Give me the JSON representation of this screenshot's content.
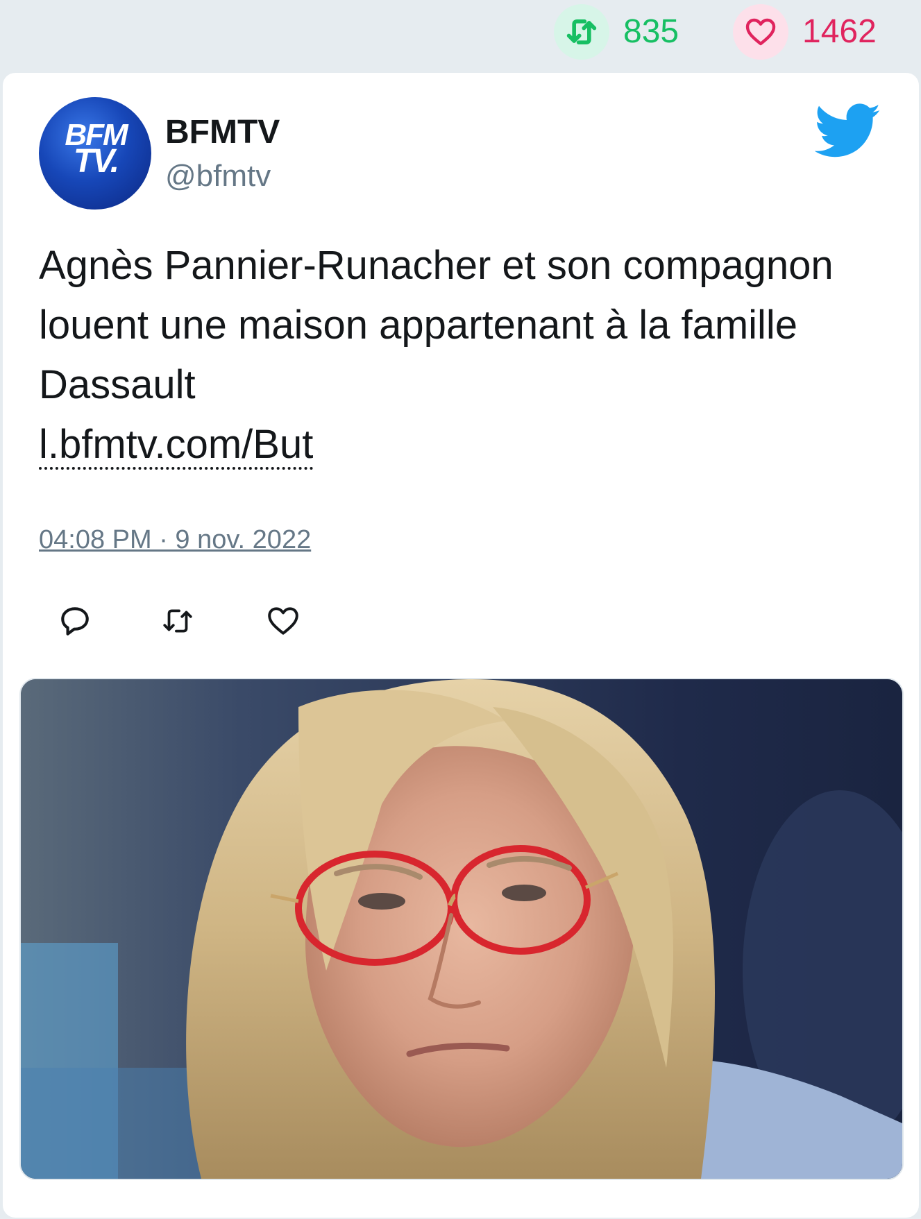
{
  "stats": {
    "retweets": "835",
    "likes": "1462"
  },
  "tweet": {
    "author_name": "BFMTV",
    "author_handle": "@bfmtv",
    "avatar_text_line1": "BFM",
    "avatar_text_line2": "TV.",
    "text": "Agnès Pannier-Runacher et son compagnon louent une maison appartenant à la famille Dassault",
    "link": "l.bfmtv.com/But",
    "timestamp": "04:08 PM · 9 nov. 2022"
  },
  "icons": {
    "retweet": "retweet-icon",
    "like": "heart-icon",
    "reply": "reply-icon",
    "brand": "twitter-bird-icon"
  },
  "colors": {
    "retweet_green": "#17bf63",
    "like_red": "#e0245e",
    "twitter_blue": "#1da1f2",
    "text_dark": "#14171a",
    "text_gray": "#657786"
  },
  "media": {
    "type": "photo"
  }
}
